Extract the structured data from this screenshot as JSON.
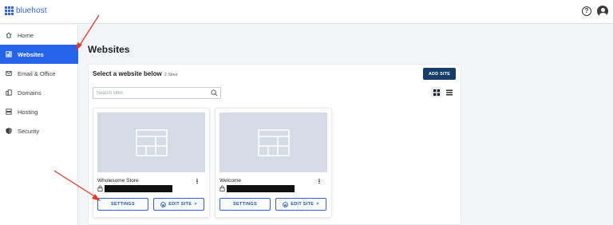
{
  "brand": {
    "name": "bluehost",
    "color": "#2f62d8"
  },
  "header": {
    "help_icon": "question-circle-icon",
    "account_icon": "user-avatar-icon"
  },
  "sidebar": {
    "active_color": "#2563eb",
    "items": [
      {
        "label": "Home",
        "icon": "home-icon",
        "active": false
      },
      {
        "label": "Websites",
        "icon": "websites-grid-icon",
        "active": true
      },
      {
        "label": "Email & Office",
        "icon": "envelope-icon",
        "active": false
      },
      {
        "label": "Domains",
        "icon": "domains-icon",
        "active": false
      },
      {
        "label": "Hosting",
        "icon": "server-icon",
        "active": false
      },
      {
        "label": "Security",
        "icon": "shield-icon",
        "active": false
      }
    ]
  },
  "main": {
    "title": "Websites",
    "panel": {
      "heading": "Select a website below",
      "count": "2 Sites",
      "add_button": "ADD SITE",
      "search_placeholder": "Search sites",
      "view_modes": [
        "grid-view-icon",
        "list-view-icon"
      ],
      "active_view": "grid"
    },
    "sites": [
      {
        "name": "Wholesome Store",
        "url": "",
        "settings_label": "SETTINGS",
        "edit_label": "EDIT SITE"
      },
      {
        "name": "Welcome",
        "url": "",
        "settings_label": "SETTINGS",
        "edit_label": "EDIT SITE"
      }
    ]
  },
  "annotation_color": "#e03a2e"
}
